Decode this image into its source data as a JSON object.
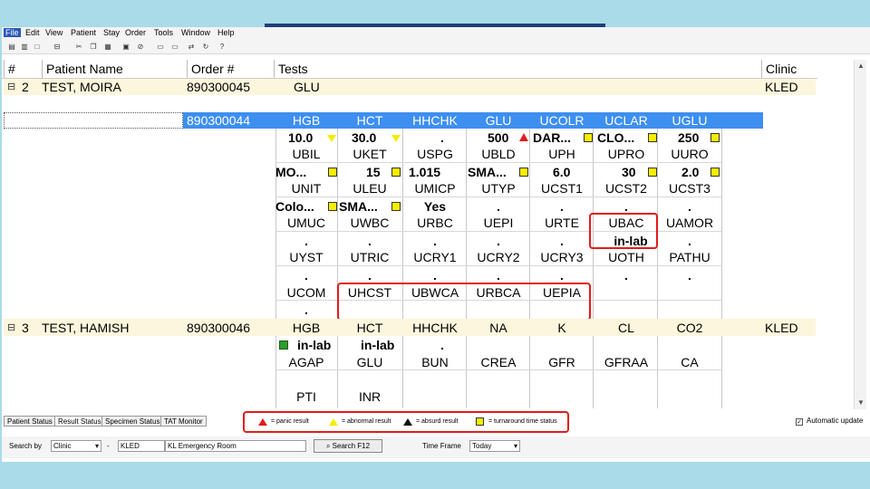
{
  "menu": [
    "File",
    "Edit",
    "View",
    "Patient",
    "Stay",
    "Order",
    "Tools",
    "Window",
    "Help"
  ],
  "toolbar_icons": [
    "print-icon",
    "print-preview-icon",
    "new-icon",
    "cut-icon",
    "copy-icon",
    "paste-icon",
    "order-icon",
    "filter-icon",
    "window-icon",
    "window2-icon",
    "refresh-icon",
    "help-icon"
  ],
  "columns": {
    "num": "#",
    "patient": "Patient Name",
    "order": "Order #",
    "tests": "Tests",
    "clinic": "Clinic"
  },
  "patients": [
    {
      "num": "2",
      "name": "TEST, MOIRA",
      "order": "890300045",
      "tests": "GLU",
      "clinic": "KLED"
    },
    {
      "order": "890300044"
    },
    {
      "num": "3",
      "name": "TEST, HAMISH",
      "order": "890300046",
      "clinic": "KLED"
    }
  ],
  "grid": {
    "r1": [
      "HGB",
      "HCT",
      "HHCHK",
      "GLU",
      "UCOLR",
      "UCLAR",
      "UGLU"
    ],
    "v1": [
      "10.0",
      "30.0",
      ".",
      "500",
      "DAR...",
      "CLO...",
      "250"
    ],
    "r2": [
      "UBIL",
      "UKET",
      "USPG",
      "UBLD",
      "UPH",
      "UPRO",
      "UURO"
    ],
    "v2": [
      "MO...",
      "15",
      "1.015",
      "SMA...",
      "6.0",
      "30",
      "2.0"
    ],
    "r3": [
      "UNIT",
      "ULEU",
      "UMICP",
      "UTYP",
      "UCST1",
      "UCST2",
      "UCST3"
    ],
    "v3": [
      "Colo...",
      "SMA...",
      "Yes",
      ".",
      ".",
      ".",
      "."
    ],
    "r4": [
      "UMUC",
      "UWBC",
      "URBC",
      "UEPI",
      "URTE",
      "UBAC",
      "UAMOR"
    ],
    "v4": [
      ".",
      ".",
      ".",
      ".",
      ".",
      "in-lab",
      "."
    ],
    "r5": [
      "UYST",
      "UTRIC",
      "UCRY1",
      "UCRY2",
      "UCRY3",
      "UOTH",
      "PATHU"
    ],
    "v5": [
      ".",
      ".",
      ".",
      ".",
      ".",
      ".",
      "."
    ],
    "r6": [
      "UCOM",
      "UHCST",
      "UBWCA",
      "URBCA",
      "UEPIA"
    ],
    "v6": [
      "."
    ],
    "h1": [
      "HGB",
      "HCT",
      "HHCHK",
      "NA",
      "K",
      "CL",
      "CO2"
    ],
    "hv1": [
      "in-lab",
      "in-lab",
      "."
    ],
    "h2": [
      "AGAP",
      "GLU",
      "BUN",
      "CREA",
      "GFR",
      "GFRAA",
      "CA"
    ],
    "h3": [
      "PTI",
      "INR"
    ]
  },
  "tabs": [
    "Patient Status",
    "Result Status",
    "Specimen Status",
    "TAT Monitor"
  ],
  "legend": [
    "= panic result",
    "= abnormal result",
    "= absurd result",
    "= turnaround time status"
  ],
  "auto_update": "Automatic update",
  "search": {
    "label": "Search by",
    "by": "Clinic",
    "dash": "-",
    "code": "KLED",
    "desc": "KL Emergency Room",
    "button": "Search F12",
    "time_label": "Time Frame",
    "time": "Today"
  },
  "colors": {
    "selection": "#3d8ff0",
    "highlight_box": "#e31b1b",
    "abnormal_flag": "#f5ee00",
    "panic_flag": "#e31b1b",
    "row_band": "#fbf6dc"
  }
}
